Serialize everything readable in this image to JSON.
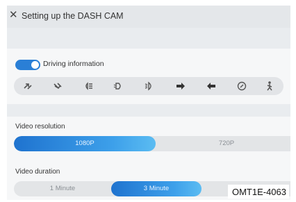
{
  "header": {
    "title": "Setting up the DASH CAM"
  },
  "driving_info": {
    "label": "Driving information",
    "enabled": true,
    "icons": [
      "steering-left-icon",
      "steering-right-icon",
      "high-beam-icon",
      "low-beam-icon",
      "fog-light-icon",
      "arrow-right-icon",
      "arrow-left-icon",
      "brake-warning-icon",
      "seatbelt-icon"
    ]
  },
  "video_resolution": {
    "label": "Video resolution",
    "options": [
      "1080P",
      "720P"
    ],
    "selected": "1080P"
  },
  "video_duration": {
    "label": "Video duration",
    "options": [
      "1 Minute",
      "3 Minute"
    ],
    "selected": "3 Minute"
  },
  "reference_code": "OMT1E-4063",
  "colors": {
    "accent": "#2a7fd6",
    "background": "#e9ecef"
  }
}
